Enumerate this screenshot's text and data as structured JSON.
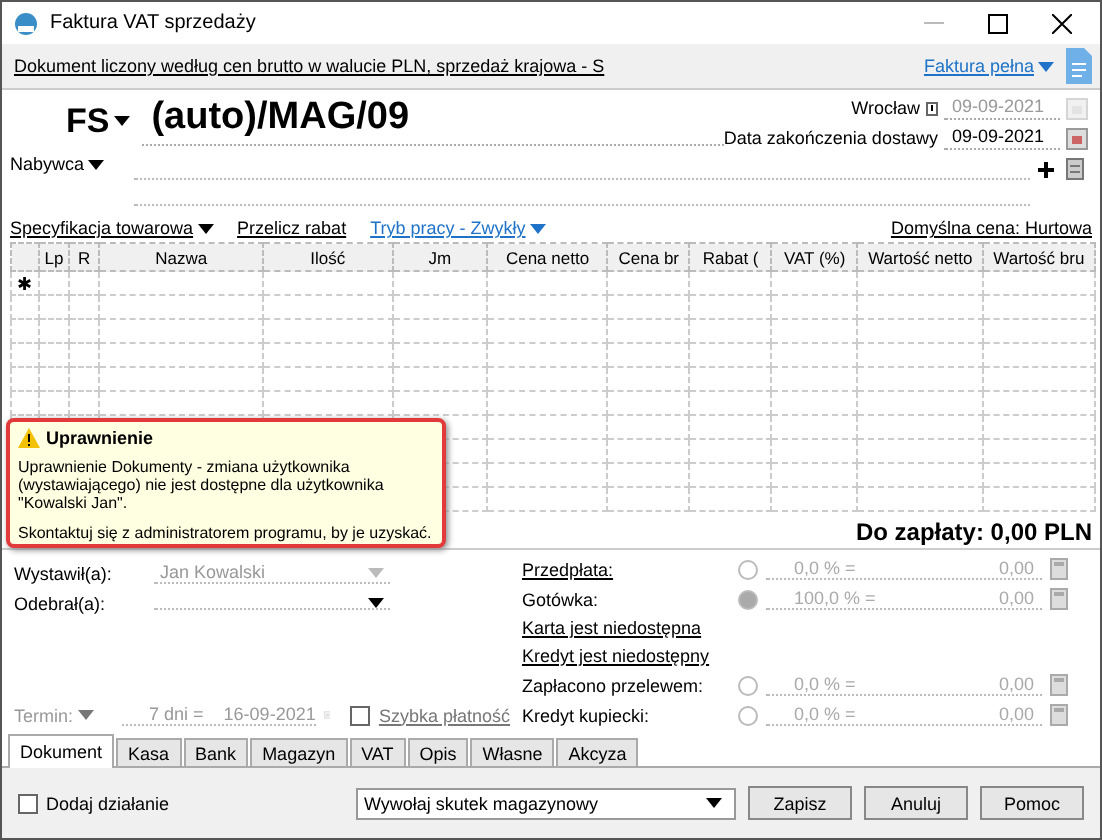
{
  "window": {
    "title": "Faktura VAT sprzedaży"
  },
  "info_bar": {
    "text": "Dokument liczony według cen brutto w walucie PLN, sprzedaż krajowa - S",
    "type_menu": "Faktura pełna"
  },
  "header": {
    "series": "FS",
    "number": "(auto)/MAG/09",
    "place": "Wrocław",
    "issue_date": "09-09-2021",
    "delivery_label": "Data zakończenia dostawy",
    "delivery_date": "09-09-2021",
    "buyer_label": "Nabywca"
  },
  "toolbar": {
    "spec": "Specyfikacja towarowa",
    "recalc": "Przelicz rabat",
    "mode": "Tryb pracy - Zwykły",
    "default_price": "Domyślna cena: Hurtowa"
  },
  "table": {
    "columns": [
      "Lp",
      "R",
      "Nazwa",
      "Ilość",
      "Jm",
      "Cena netto",
      "Cena br",
      "Rabat (",
      "VAT (%)",
      "Wartość netto",
      "Wartość bru"
    ],
    "new_row_marker": "✱"
  },
  "tooltip": {
    "title": "Uprawnienie",
    "text": "Uprawnienie Dokumenty - zmiana użytkownika (wystawiającego) nie jest dostępne dla użytkownika \"Kowalski Jan\".",
    "hint": "Skontaktuj się z administratorem programu, by je uzyskać."
  },
  "total": "Do zapłaty: 0,00 PLN",
  "people": [
    {
      "label": "Wystawił(a):",
      "value": "Jan Kowalski",
      "disabled": true
    },
    {
      "label": "Odebrał(a):",
      "disabled": false
    }
  ],
  "payments": [
    {
      "kind": "radio",
      "label": "Przedpłata:",
      "link": true,
      "selected": false,
      "percent": "0,0 % =",
      "amount": "0,00"
    },
    {
      "kind": "radio",
      "label": "Gotówka:",
      "link": false,
      "selected": true,
      "percent": "100,0 % =",
      "amount": "0,00"
    },
    {
      "kind": "link",
      "label": "Karta jest niedostępna"
    },
    {
      "kind": "link",
      "label": "Kredyt jest niedostępny"
    },
    {
      "kind": "radio",
      "label": "Zapłacono przelewem:",
      "link": false,
      "selected": false,
      "percent": "0,0 % =",
      "amount": "0,00"
    },
    {
      "kind": "radio",
      "label": "Kredyt kupiecki:",
      "link": false,
      "selected": false,
      "percent": "0,0 % =",
      "amount": "0,00"
    }
  ],
  "term": {
    "label": "Termin:",
    "days": "7 dni =",
    "date": "16-09-2021",
    "quick_pay": "Szybka płatność",
    "quick_pay_checked": false
  },
  "tabs": [
    {
      "label": "Dokument",
      "selected": true
    },
    {
      "label": "Kasa",
      "selected": false
    },
    {
      "label": "Bank",
      "selected": false
    },
    {
      "label": "Magazyn",
      "selected": false
    },
    {
      "label": "VAT",
      "selected": false
    },
    {
      "label": "Opis",
      "selected": false
    },
    {
      "label": "Własne",
      "selected": false
    },
    {
      "label": "Akcyza",
      "selected": false
    }
  ],
  "footer": {
    "add_action": "Dodaj działanie",
    "add_action_checked": false,
    "warehouse": "Wywołaj skutek magazynowy",
    "buttons": [
      "Zapisz",
      "Anuluj",
      "Pomoc"
    ]
  }
}
